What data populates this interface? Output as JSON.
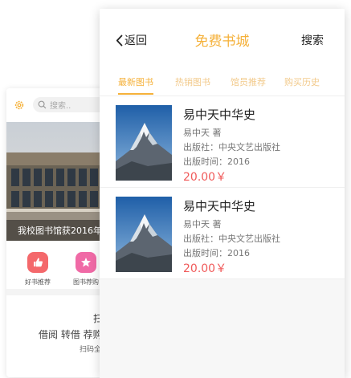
{
  "background_screen": {
    "search_placeholder": "搜索..",
    "banner_caption": "我校图书馆获2016年",
    "shortcuts": [
      {
        "label": "好书推荐",
        "icon": "thumbs-up-icon",
        "color": "#f4686b"
      },
      {
        "label": "图书荐购",
        "icon": "star-icon",
        "color": "#f06aa6"
      }
    ],
    "scan_title": "扫",
    "scan_desc": "借阅 转借 荐购",
    "scan_small": "扫码全"
  },
  "header": {
    "back_label": "返回",
    "title": "免费书城",
    "search_label": "搜索"
  },
  "tabs": [
    {
      "label": "最新图书",
      "active": true
    },
    {
      "label": "热销图书",
      "active": false
    },
    {
      "label": "馆员推荐",
      "active": false
    },
    {
      "label": "购买历史",
      "active": false
    }
  ],
  "books": [
    {
      "title": "易中天中华史",
      "author": "易中天 著",
      "publisher": "出版社：中央文艺出版社",
      "date": "出版时间：2016",
      "price": "20.00￥"
    },
    {
      "title": "易中天中华史",
      "author": "易中天 著",
      "publisher": "出版社：中央文艺出版社",
      "date": "出版时间：2016",
      "price": "20.00￥"
    }
  ],
  "colors": {
    "accent": "#f5b13a",
    "price": "#f05a5a"
  }
}
